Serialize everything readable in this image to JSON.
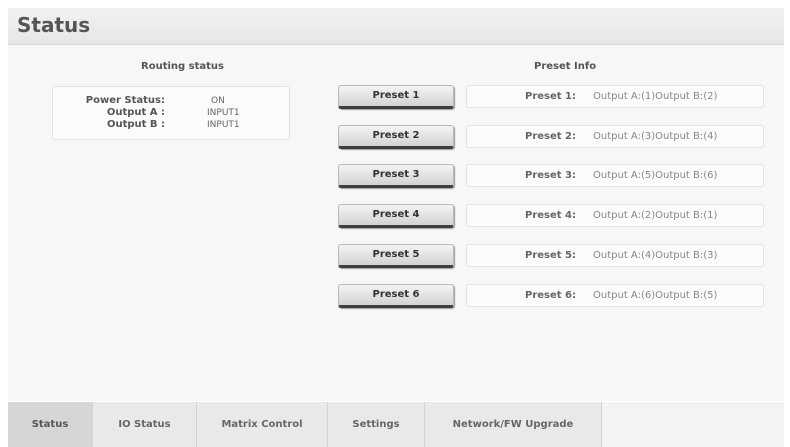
{
  "header": {
    "title": "Status"
  },
  "routing": {
    "title": "Routing status",
    "rows": [
      {
        "label": "Power Status:",
        "value": "ON"
      },
      {
        "label": "Output A :",
        "value": "INPUT1"
      },
      {
        "label": "Output B :",
        "value": "INPUT1"
      }
    ]
  },
  "preset_info": {
    "title": "Preset Info"
  },
  "presets": [
    {
      "button": "Preset 1",
      "name": "Preset 1:",
      "value": "Output A:(1)Output B:(2)"
    },
    {
      "button": "Preset 2",
      "name": "Preset 2:",
      "value": "Output A:(3)Output B:(4)"
    },
    {
      "button": "Preset 3",
      "name": "Preset 3:",
      "value": "Output A:(5)Output B:(6)"
    },
    {
      "button": "Preset 4",
      "name": "Preset 4:",
      "value": "Output A:(2)Output B:(1)"
    },
    {
      "button": "Preset 5",
      "name": "Preset 5:",
      "value": "Output A:(4)Output B:(3)"
    },
    {
      "button": "Preset 6",
      "name": "Preset 6:",
      "value": "Output A:(6)Output B:(5)"
    }
  ],
  "tabs": [
    {
      "label": "Status"
    },
    {
      "label": "IO Status"
    },
    {
      "label": "Matrix Control"
    },
    {
      "label": "Settings"
    },
    {
      "label": "Network/FW Upgrade"
    }
  ],
  "active_tab": "Status"
}
